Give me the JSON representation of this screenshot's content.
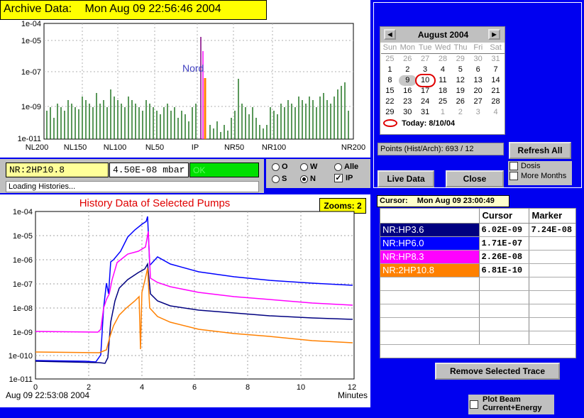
{
  "archive": {
    "label": "Archive Data:",
    "datetime": "Mon Aug 09 22:56:46 2004",
    "y_ticks": [
      "1e-04",
      "1e-05",
      "1e-07",
      "1e-09",
      "1e-011"
    ],
    "x_ticks": [
      "NL200",
      "NL150",
      "NL100",
      "NL50",
      "IP",
      "NR50",
      "NR100",
      "NR200"
    ],
    "annotation": "Nord"
  },
  "pump": {
    "name": "NR:2HP10.8",
    "value": "4.50E-08 mbar",
    "status": "OK",
    "status_color": "#00e000",
    "loading": "Loading Histories..."
  },
  "radios": {
    "o": "O",
    "w": "W",
    "alle": "Alle",
    "s": "S",
    "n": "N",
    "ip": "IP",
    "selected": "N",
    "ip_checked": "✓"
  },
  "calendar": {
    "month": "August 2004",
    "weekdays": [
      "Sun",
      "Mon",
      "Tue",
      "Wed",
      "Thu",
      "Fri",
      "Sat"
    ],
    "weeks": [
      [
        "25",
        "26",
        "27",
        "28",
        "29",
        "30",
        "31"
      ],
      [
        "1",
        "2",
        "3",
        "4",
        "5",
        "6",
        "7"
      ],
      [
        "8",
        "9",
        "10",
        "11",
        "12",
        "13",
        "14"
      ],
      [
        "15",
        "16",
        "17",
        "18",
        "19",
        "20",
        "21"
      ],
      [
        "22",
        "23",
        "24",
        "25",
        "26",
        "27",
        "28"
      ],
      [
        "29",
        "30",
        "31",
        "1",
        "2",
        "3",
        "4"
      ]
    ],
    "today_label": "Today: 8/10/04"
  },
  "points": "Points (Hist/Arch): 693 / 12",
  "buttons": {
    "refresh": "Refresh All",
    "live": "Live Data",
    "close": "Close",
    "remove": "Remove Selected Trace"
  },
  "checks": {
    "dosis": "Dosis",
    "more_months": "More Months",
    "plot_beam_1": "Plot Beam",
    "plot_beam_2": "Current+Energy"
  },
  "history": {
    "title": "History Data of Selected Pumps",
    "zooms": "Zooms: 2",
    "start": "Aug 09 22:53:08 2004",
    "xlabel": "Minutes",
    "y_ticks": [
      "1e-04",
      "1e-05",
      "1e-06",
      "1e-07",
      "1e-08",
      "1e-09",
      "1e-010",
      "1e-011"
    ],
    "x_ticks": [
      "0",
      "2",
      "4",
      "6",
      "8",
      "10",
      "12"
    ]
  },
  "cursor": {
    "label": "Cursor:",
    "datetime": "Mon Aug 09 23:00:49",
    "col_cursor": "Cursor",
    "col_marker": "Marker",
    "rows": [
      {
        "name": "NR:HP3.6",
        "cursor": "6.02E-09",
        "marker": "7.24E-08",
        "color": "#000080"
      },
      {
        "name": "NR:HP6.0",
        "cursor": "1.71E-07",
        "marker": "",
        "color": "#0000ff"
      },
      {
        "name": "NR:HP8.3",
        "cursor": "2.26E-08",
        "marker": "",
        "color": "#ff00ff"
      },
      {
        "name": "NR:2HP10.8",
        "cursor": "6.81E-10",
        "marker": "",
        "color": "#ff8000"
      }
    ]
  }
}
